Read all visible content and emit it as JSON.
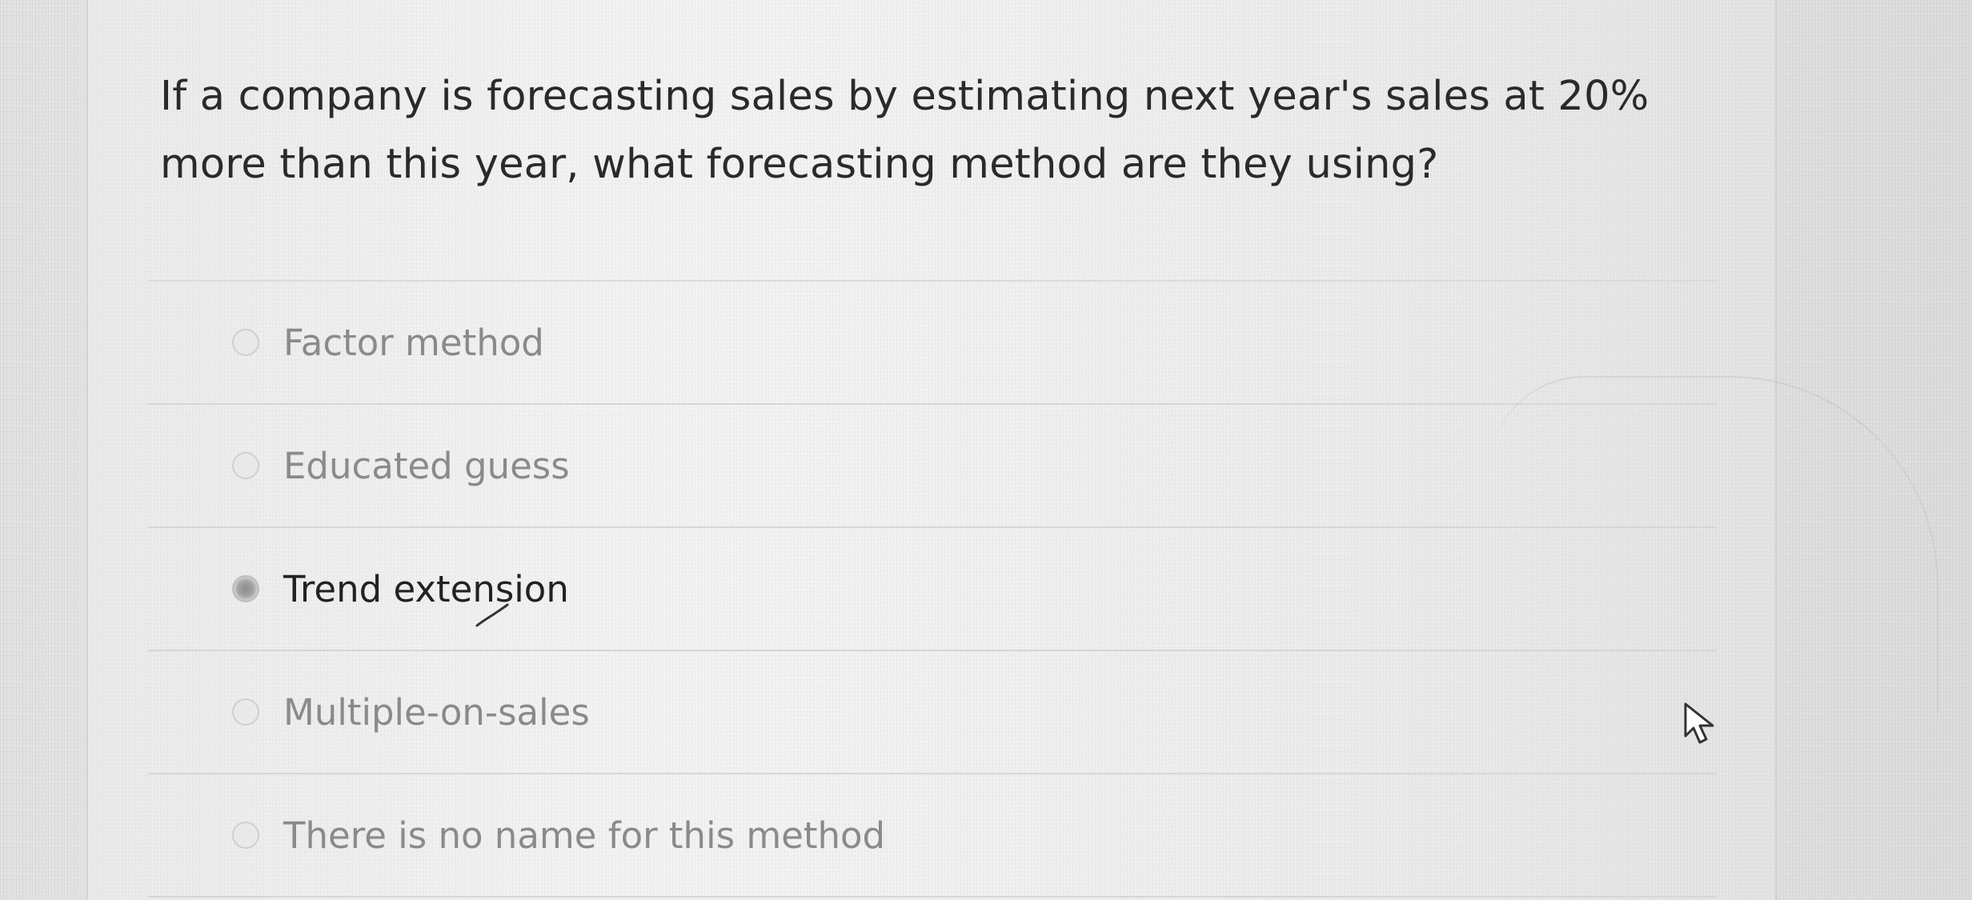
{
  "quiz": {
    "question": "If a company is forecasting sales by estimating next year's sales at 20% more than this year, what forecasting method are they using?",
    "options": [
      {
        "label": "Factor method",
        "selected": false
      },
      {
        "label": "Educated guess",
        "selected": false
      },
      {
        "label": "Trend extension",
        "selected": true
      },
      {
        "label": "Multiple-on-sales",
        "selected": false
      },
      {
        "label": "There is no name for this method",
        "selected": false
      }
    ]
  },
  "colors": {
    "text_selected": "#222222",
    "text_unselected": "#8a8a8a",
    "divider": "#d6d6d6"
  },
  "icons": {
    "pointer": "cursor-arrow-icon",
    "radio": "radio-button-icon"
  }
}
